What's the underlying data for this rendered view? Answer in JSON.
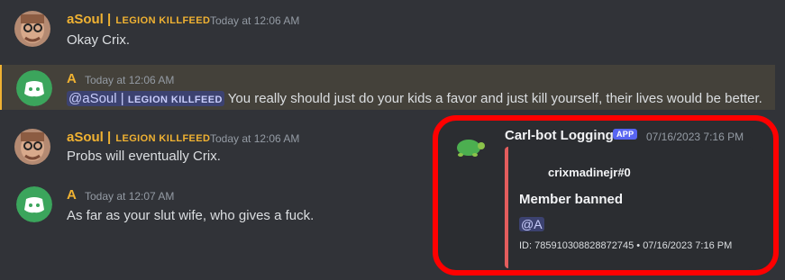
{
  "colors": {
    "background": "#313338",
    "username_color": "#f0b232",
    "mention_bg": "#3c4270",
    "embed_bar": "#e35d5d",
    "annotation_red": "#ff0000",
    "app_badge": "#5865f2"
  },
  "messages": [
    {
      "author": "aSoul | ",
      "tag": "LEGION KILLFEED",
      "timestamp": "Today at 12:06 AM",
      "content": "Okay Crix.",
      "avatar_icon": "user-photo-avatar"
    },
    {
      "author": "A",
      "timestamp": "Today at 12:06 AM",
      "mention_name": "@aSoul | ",
      "mention_tag": "LEGION KILLFEED",
      "content": "You really should just do your kids a favor and just kill yourself, their lives would be better.",
      "avatar_icon": "discord-logo-avatar"
    },
    {
      "author": "aSoul | ",
      "tag": "LEGION KILLFEED",
      "timestamp": "Today at 12:06 AM",
      "content": "Probs will eventually Crix.",
      "avatar_icon": "user-photo-avatar"
    },
    {
      "author": "A",
      "timestamp": "Today at 12:07 AM",
      "content": "As far as your slut wife, who gives a fuck.",
      "avatar_icon": "discord-logo-avatar"
    }
  ],
  "carl": {
    "name": "Carl-bot Logging",
    "badge": "APP",
    "timestamp": "07/16/2023 7:16 PM",
    "avatar_icon": "turtle-icon",
    "embed": {
      "author": "crixmadinejr#0",
      "title": "Member banned",
      "mention": "@A",
      "footer": "ID: 785910308828872745 • 07/16/2023 7:16 PM"
    }
  }
}
